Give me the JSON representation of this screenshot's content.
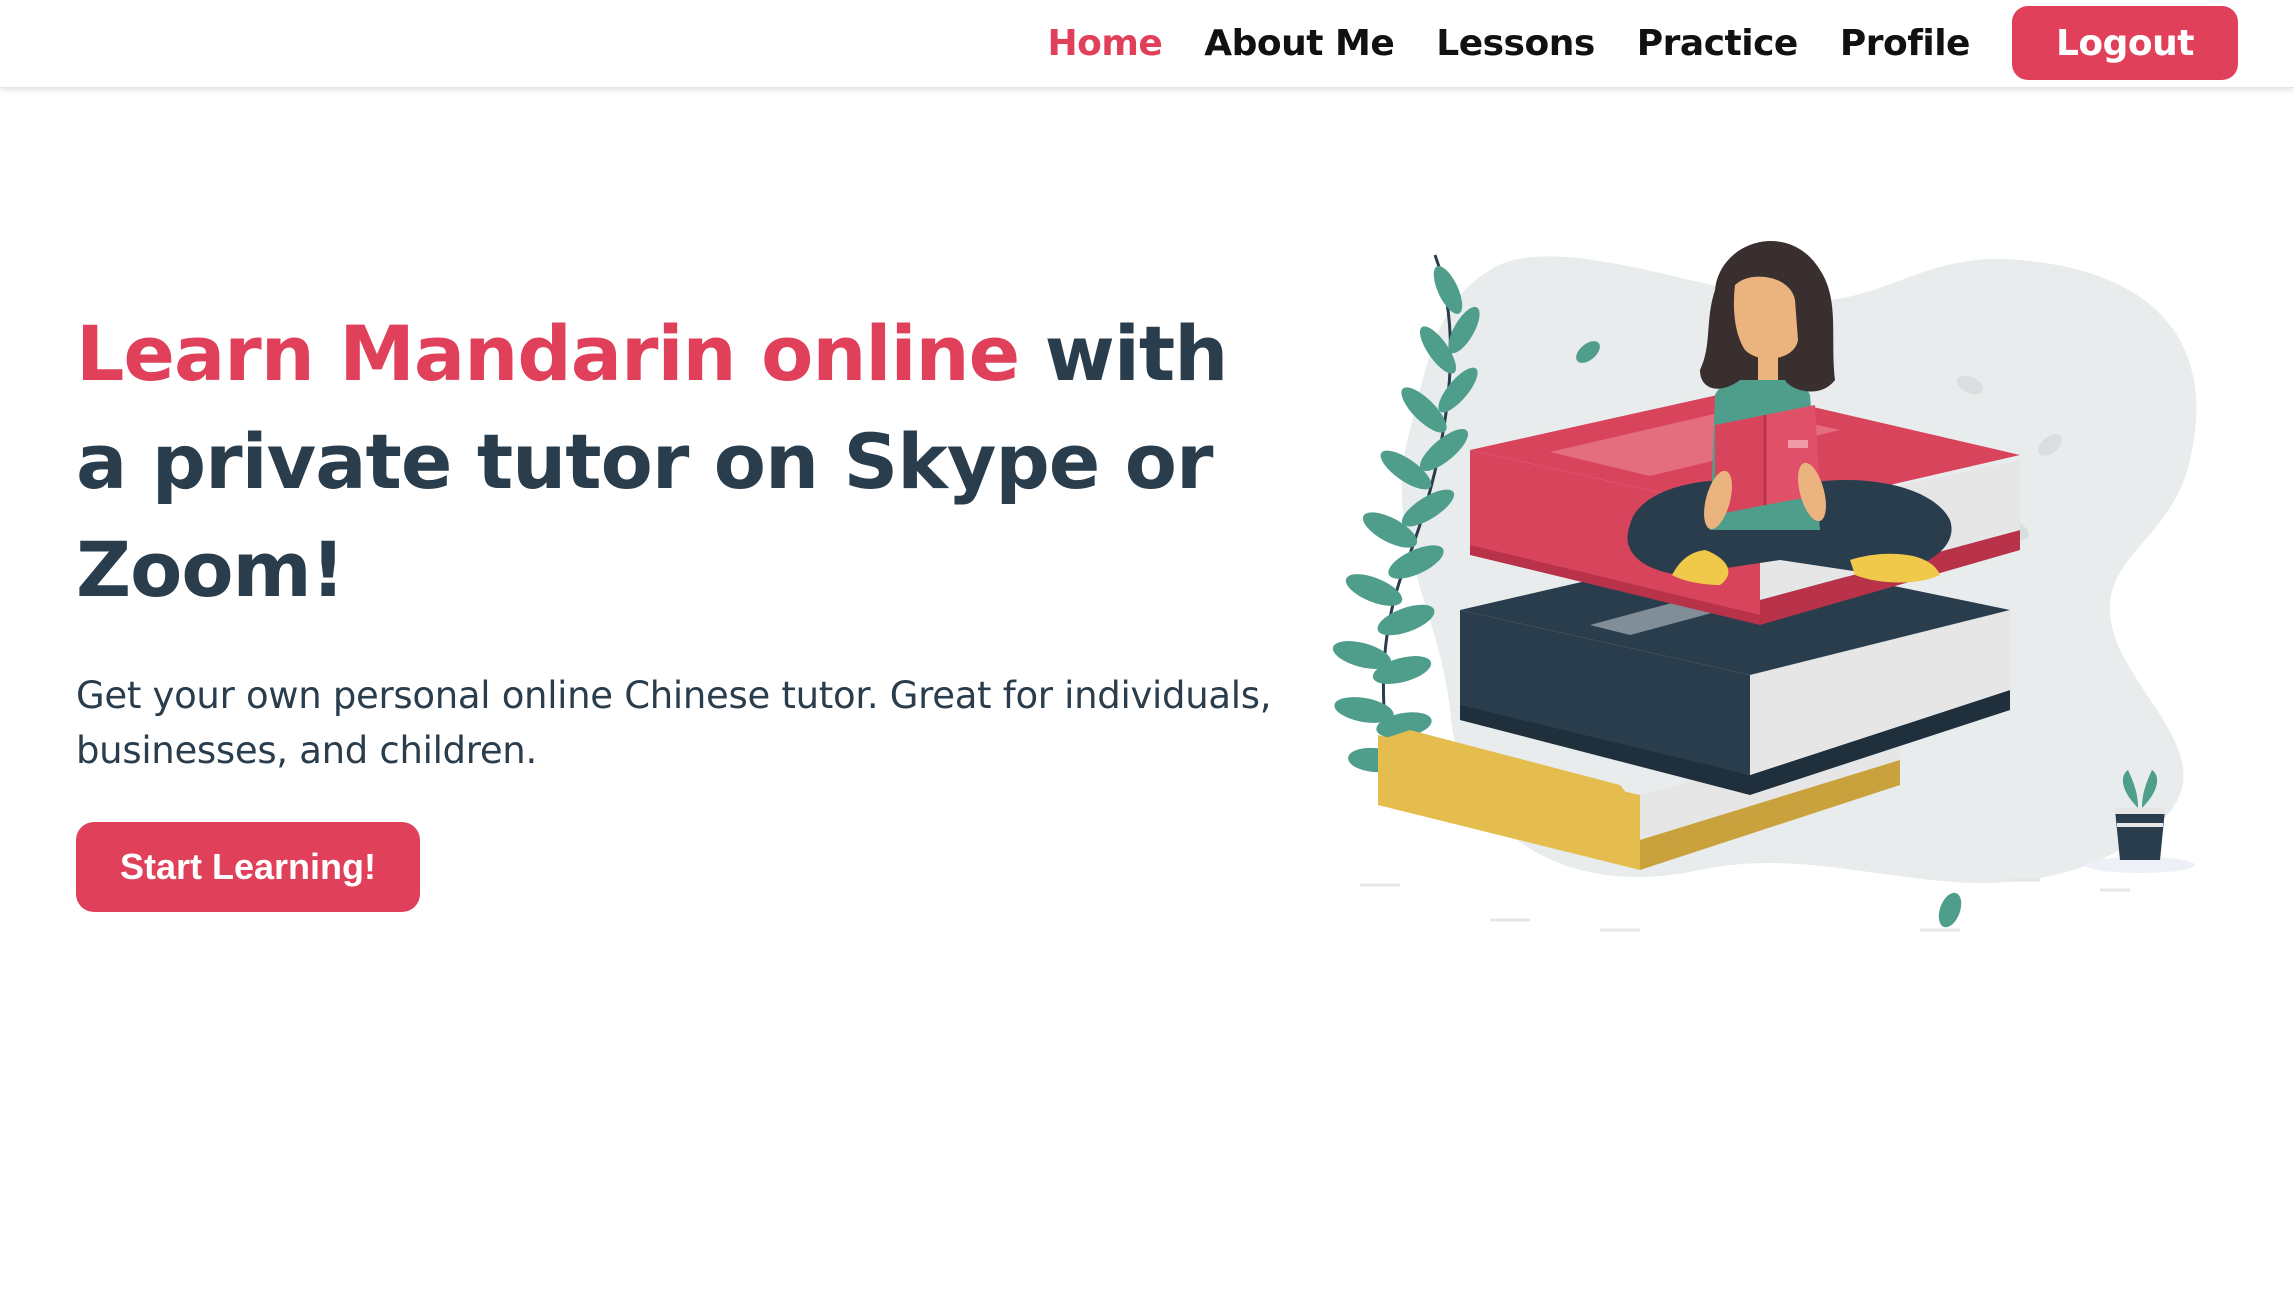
{
  "nav": {
    "items": [
      {
        "label": "Home",
        "active": true
      },
      {
        "label": "About Me",
        "active": false
      },
      {
        "label": "Lessons",
        "active": false
      },
      {
        "label": "Practice",
        "active": false
      },
      {
        "label": "Profile",
        "active": false
      }
    ],
    "logout_label": "Logout"
  },
  "hero": {
    "title_accent": "Learn Mandarin online",
    "title_rest": " with a private tutor on Skype or Zoom!",
    "subtitle": "Get your own personal online Chinese tutor. Great for individuals, businesses, and children.",
    "cta_label": "Start Learning!"
  },
  "illustration": {
    "icon": "woman-reading-on-books-illustration"
  },
  "colors": {
    "accent": "#e0405a",
    "heading": "#2a3d4d",
    "nav_text": "#111111",
    "background": "#ffffff"
  }
}
